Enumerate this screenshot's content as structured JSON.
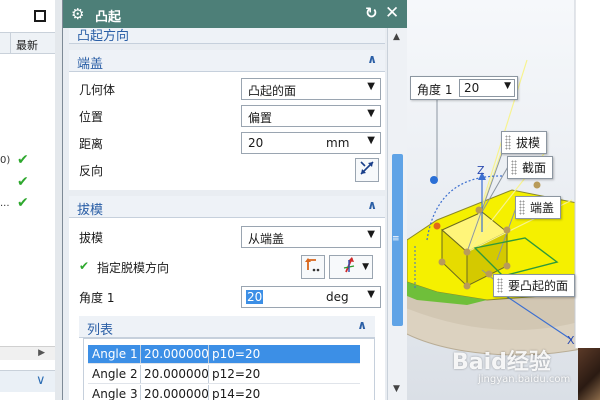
{
  "left_panel": {
    "column_header": "最新",
    "rows": [
      {
        "text": "0)",
        "check": "✔"
      },
      {
        "text": "",
        "check": "✔"
      },
      {
        "text": "...",
        "check": "✔"
      }
    ]
  },
  "dialog": {
    "title": "凸起",
    "prev_section": "凸起方向",
    "end_cap": {
      "title": "端盖",
      "geometry": {
        "label": "几何体",
        "value": "凸起的面"
      },
      "location": {
        "label": "位置",
        "value": "偏置"
      },
      "distance": {
        "label": "距离",
        "value": "20",
        "unit": "mm"
      },
      "reverse": {
        "label": "反向"
      }
    },
    "draft": {
      "title": "拔模",
      "draft": {
        "label": "拔模",
        "value": "从端盖"
      },
      "direction": {
        "label": "指定脱模方向"
      },
      "angle": {
        "label": "角度 1",
        "value": "20",
        "unit": "deg"
      },
      "list": {
        "title": "列表",
        "rows": [
          {
            "name": "Angle 1",
            "value": "20.000000",
            "expr": "p10=20"
          },
          {
            "name": "Angle 2",
            "value": "20.000000",
            "expr": "p12=20"
          },
          {
            "name": "Angle 3",
            "value": "20.000000",
            "expr": "p14=20"
          }
        ]
      }
    }
  },
  "viewport": {
    "angle_label": "角度 1",
    "angle_value": "20",
    "callouts": {
      "draft": "拔模",
      "section": "截面",
      "end_cap": "端盖",
      "face": "要凸起的面"
    },
    "axis_z": "Z",
    "axis_x": "X",
    "watermark": "Baid经验",
    "watermark_sub": "jingyan.baidu.com"
  },
  "colors": {
    "titlebar": "#4d7f78",
    "section_title": "#2b5fa6",
    "selection": "#3c8fe6",
    "solid": "#f5f000",
    "check": "#2ea82e"
  }
}
